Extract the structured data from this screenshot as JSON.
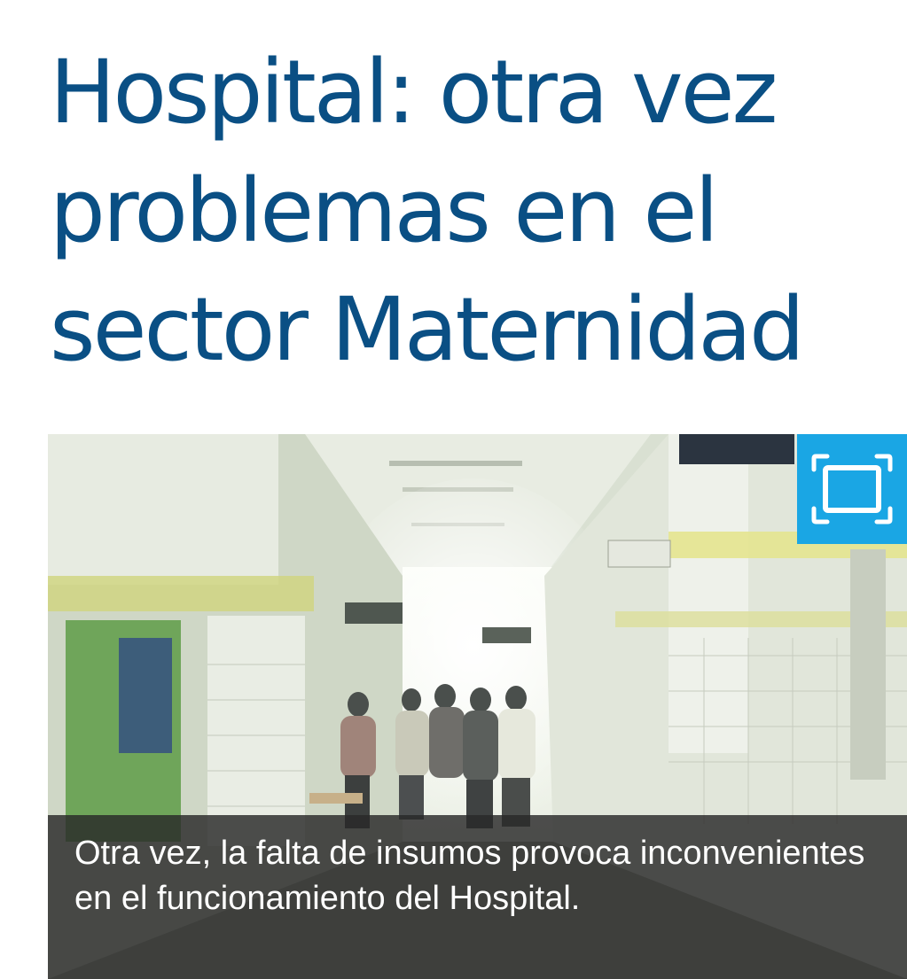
{
  "article": {
    "headline_lines": [
      "Hospital: otra vez",
      "problemas en el",
      "sector Maternidad"
    ],
    "photo": {
      "caption": "Otra vez, la falta de insumos provoca inconvenientes en el funcionamiento del Hospital.",
      "expand_icon": "fullscreen-icon",
      "expand_color": "#1aa6e4"
    }
  },
  "colors": {
    "headline": "#0a4f84",
    "caption_background": "#282828"
  }
}
